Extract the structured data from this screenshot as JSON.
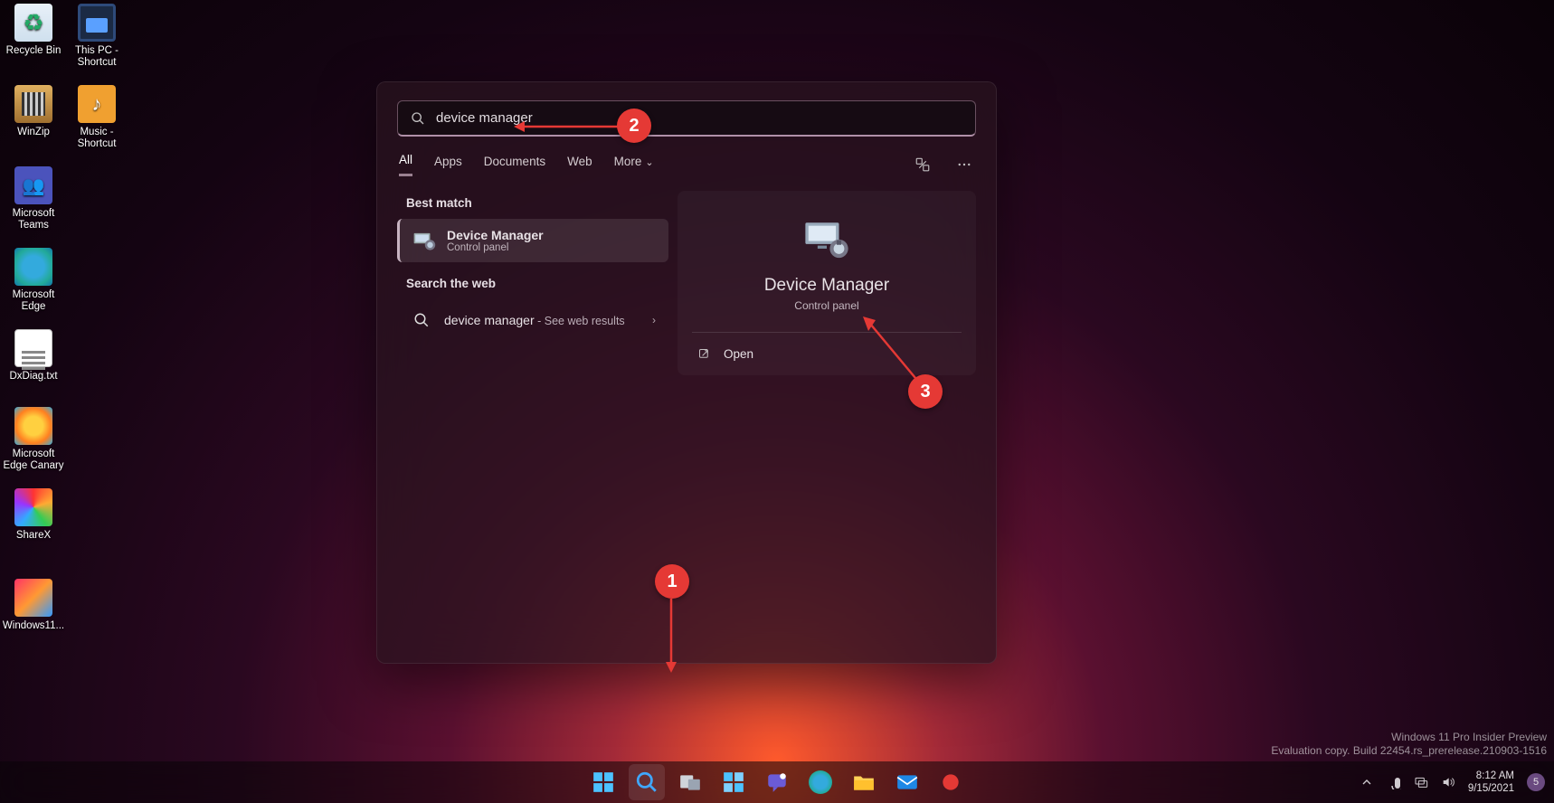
{
  "desktop_icons": [
    {
      "label": "Recycle Bin"
    },
    {
      "label": "This PC - Shortcut"
    },
    {
      "label": "WinZip"
    },
    {
      "label": "Music - Shortcut"
    },
    {
      "label": "Microsoft Teams"
    },
    {
      "label": "Microsoft Edge"
    },
    {
      "label": "DxDiag.txt"
    },
    {
      "label": "Microsoft Edge Canary"
    },
    {
      "label": "ShareX"
    },
    {
      "label": "Windows11..."
    }
  ],
  "search": {
    "query": "device manager",
    "filters": [
      "All",
      "Apps",
      "Documents",
      "Web",
      "More"
    ],
    "active_filter": "All",
    "section_best": "Best match",
    "best_result": {
      "title": "Device Manager",
      "subtitle": "Control panel"
    },
    "section_web": "Search the web",
    "web_result": {
      "query": "device manager",
      "suffix": " - See web results"
    },
    "preview": {
      "title": "Device Manager",
      "subtitle": "Control panel",
      "action": "Open"
    }
  },
  "annotations": {
    "n1": "1",
    "n2": "2",
    "n3": "3"
  },
  "watermark": {
    "l1": "Windows 11 Pro Insider Preview",
    "l2": "Evaluation copy. Build 22454.rs_prerelease.210903-1516"
  },
  "tray": {
    "time": "8:12 AM",
    "date": "9/15/2021",
    "notif": "5"
  }
}
